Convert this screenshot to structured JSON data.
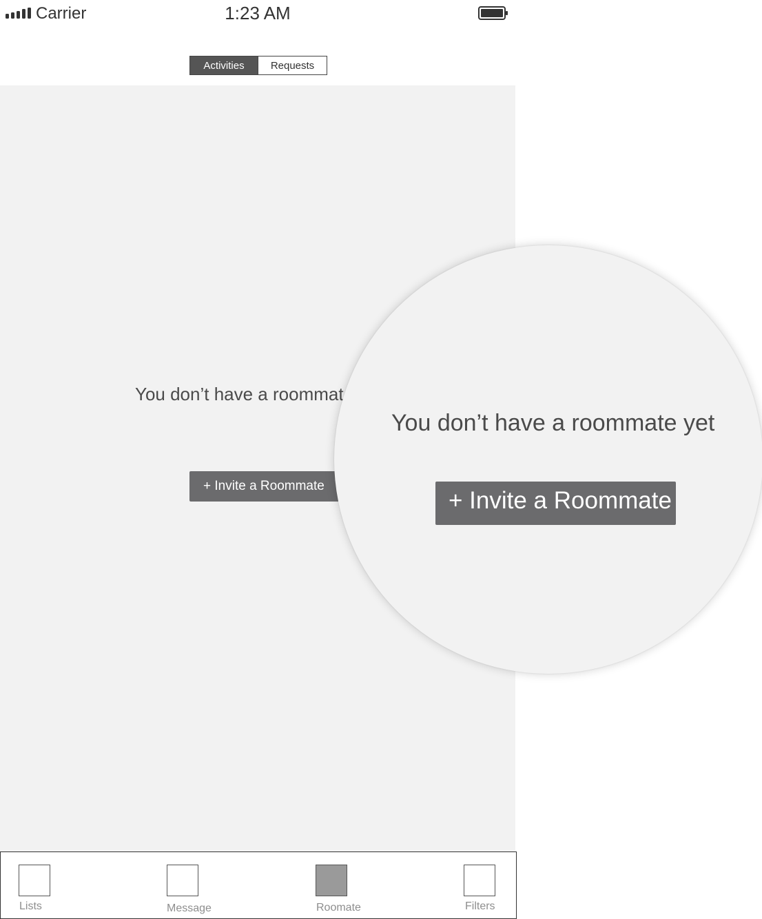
{
  "status_bar": {
    "carrier": "Carrier",
    "time": "1:23 AM",
    "signal_icon": "signal-bars-icon",
    "battery_icon": "battery-full-icon"
  },
  "segmented_control": {
    "tabs": [
      {
        "label": "Activities",
        "selected": true
      },
      {
        "label": "Requests",
        "selected": false
      }
    ]
  },
  "empty_state": {
    "message": "You don’t have a roommate yet",
    "visible_message": "You don’t have a roommat",
    "invite_label": "+ Invite a Roommate"
  },
  "magnifier": {
    "message": "You don’t have a roommate yet",
    "invite_label": "+ Invite a Roommate"
  },
  "tab_bar": {
    "items": [
      {
        "label": "Lists",
        "icon": "placeholder-square-icon",
        "active": false
      },
      {
        "label": "Message",
        "icon": "placeholder-square-icon",
        "active": false
      },
      {
        "label": "Roomate",
        "icon": "placeholder-square-icon",
        "active": true
      },
      {
        "label": "Filters",
        "icon": "placeholder-square-icon",
        "active": false
      }
    ]
  },
  "colors": {
    "background": "#f2f2f2",
    "button": "#6b6b6d",
    "segment_selected": "#555555",
    "text": "#4a4a4a",
    "tab_label": "#8e8e8e",
    "active_tab_icon": "#9a9a9a"
  }
}
